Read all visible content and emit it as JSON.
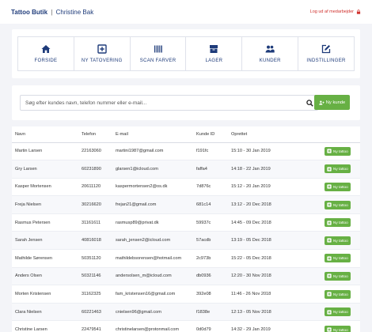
{
  "header": {
    "shop_name": "Tattoo Butik",
    "separator": "|",
    "user_name": "Christine Bak",
    "logout_label": "Log ud af medarbejder"
  },
  "nav": [
    {
      "label": "FORSIDE",
      "icon": "home-icon"
    },
    {
      "label": "NY TATOVERING",
      "icon": "plus-square-icon"
    },
    {
      "label": "SCAN FARVER",
      "icon": "barcode-icon"
    },
    {
      "label": "LAGER",
      "icon": "boxes-icon"
    },
    {
      "label": "KUNDER",
      "icon": "users-icon"
    },
    {
      "label": "INDSTILLINGER",
      "icon": "edit-icon"
    }
  ],
  "search": {
    "placeholder": "Søg efter kundes navn, telefon nummer eller e-mail...",
    "add_customer_label": "Ny kunde"
  },
  "table": {
    "headers": [
      "Navn",
      "Telefon",
      "E-mail",
      "Kunde ID",
      "Oprettet",
      ""
    ],
    "row_button_label": "Ny tattoo",
    "rows": [
      {
        "name": "Martin Larsen",
        "phone": "22163060",
        "email": "martini1987@gmail.com",
        "id": "f191fc",
        "created": "15:10 - 30 Jan 2019"
      },
      {
        "name": "Gry Larsen",
        "phone": "60231890",
        "email": "glarsen1@icloud.com",
        "id": "faffa4",
        "created": "14:18 - 22 Jan 2019"
      },
      {
        "name": "Kasper Mortensen",
        "phone": "20611120",
        "email": "kaspermortensen2@os.dk",
        "id": "7d876c",
        "created": "15:12 - 20 Jan 2019"
      },
      {
        "name": "Freja Nielsen",
        "phone": "30216620",
        "email": "frejan21@gmail.com",
        "id": "681c14",
        "created": "13:12 - 20 Dec 2018"
      },
      {
        "name": "Rasmus Petersen",
        "phone": "31161611",
        "email": "rasmusp89@privat.dk",
        "id": "59937c",
        "created": "14:45 - 09 Dec 2018"
      },
      {
        "name": "Sarah Jensen",
        "phone": "40816018",
        "email": "sarah_jensen2@icloud.com",
        "id": "57acdb",
        "created": "13:19 - 05 Dec 2018"
      },
      {
        "name": "Mathilde Sørensen",
        "phone": "50351120",
        "email": "mathildebsorensen@hotmail.com",
        "id": "2c973b",
        "created": "15:22 - 05 Dec 2018"
      },
      {
        "name": "Anders Olsen",
        "phone": "50321146",
        "email": "andersolsen_m@icloud.com",
        "id": "db0936",
        "created": "12:20 - 30 Nov 2018"
      },
      {
        "name": "Morten Kristensen",
        "phone": "31162325",
        "email": "fam_kristensen16@gmail.com",
        "id": "392e08",
        "created": "11:46 - 26 Nov 2018"
      },
      {
        "name": "Clara Nielsen",
        "phone": "60221463",
        "email": "cnielsen96@gmail.com",
        "id": "f1838e",
        "created": "12:13 - 05 Nov 2018"
      },
      {
        "name": "Christine Larsen",
        "phone": "22479541",
        "email": "christinelarsen@protonmail.com",
        "id": "0d0d79",
        "created": "14:32 - 29 Jan 2019"
      }
    ]
  },
  "colors": {
    "brand_blue": "#1e3b7a",
    "accent_green": "#67b044",
    "logout_red": "#d0312d",
    "page_bg": "#f3f4f8"
  }
}
